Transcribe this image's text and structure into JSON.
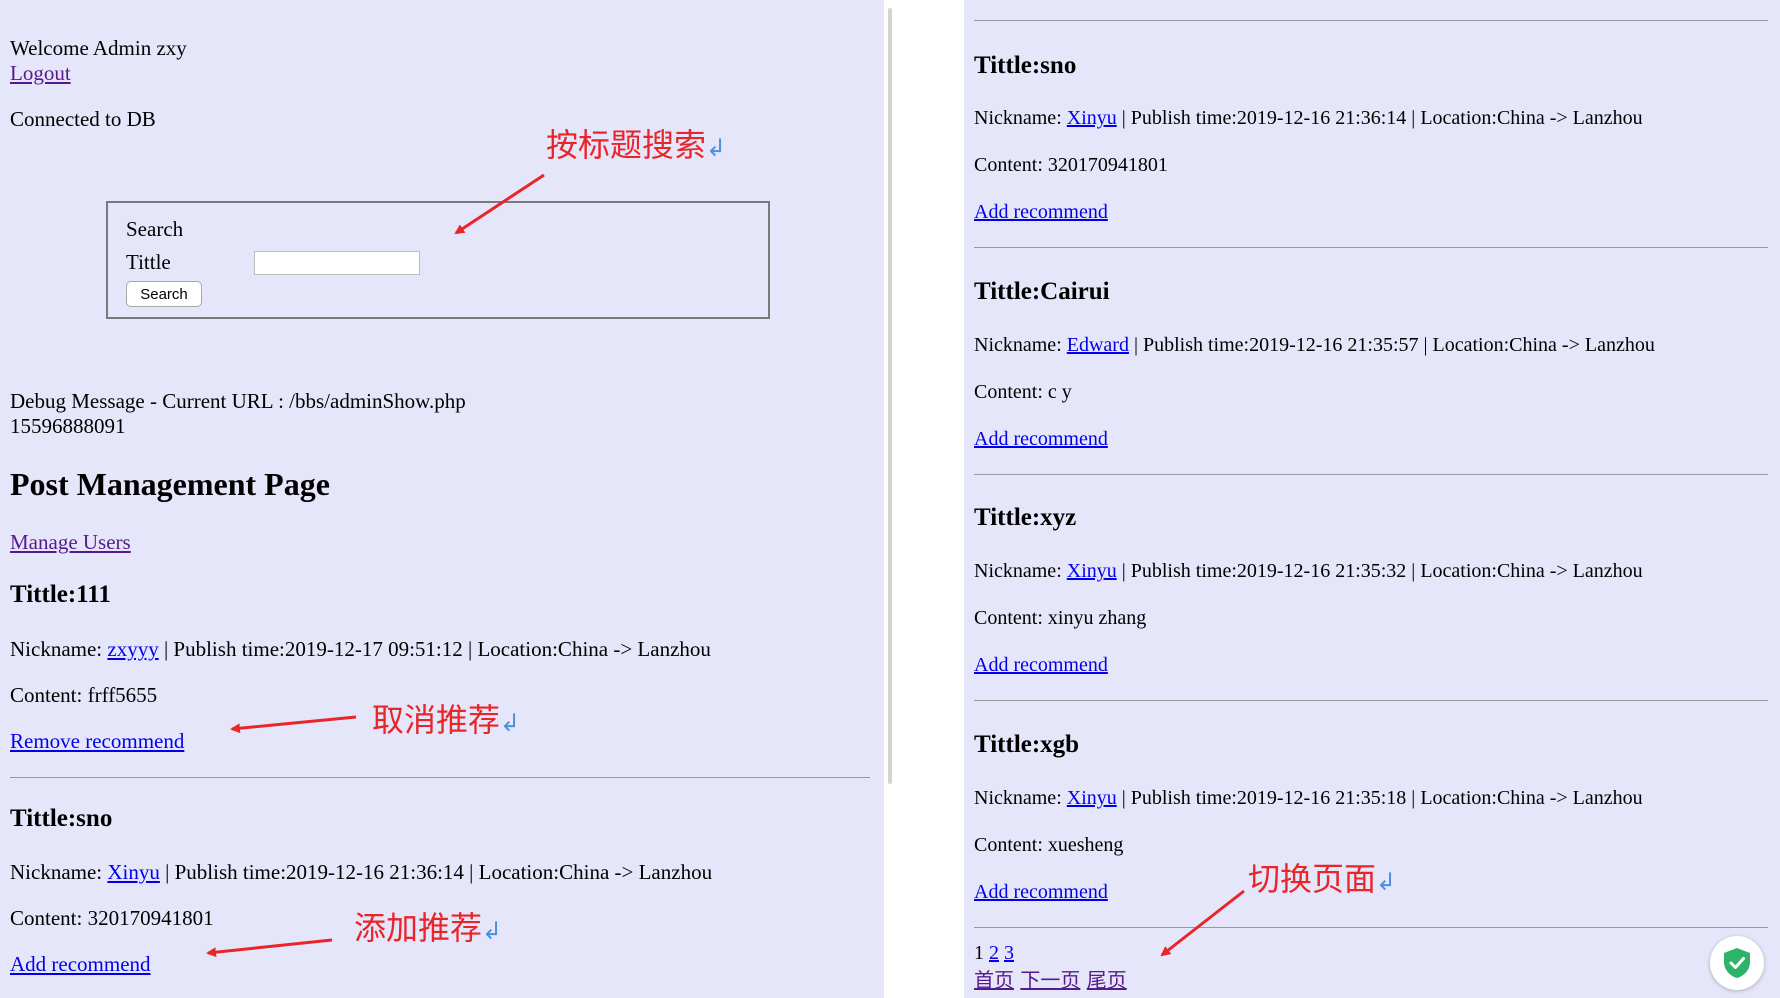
{
  "header": {
    "welcome": "Welcome Admin zxy",
    "logout": "Logout",
    "db_status": "Connected to DB"
  },
  "search": {
    "legend": "Search",
    "label": "Tittle",
    "value": "",
    "button": "Search"
  },
  "debug": {
    "message": "Debug Message - Current URL : /bbs/adminShow.php",
    "id": "15596888091"
  },
  "page_title": "Post Management Page",
  "manage_users": "Manage Users",
  "labels": {
    "nickname": "Nickname: ",
    "content": "Content: "
  },
  "posts_left": [
    {
      "title": "Tittle:111",
      "nickname": "zxyyy",
      "meta": " | Publish time:2019-12-17 09:51:12 | Location:China -> Lanzhou",
      "content": "frff5655",
      "action": "Remove recommend"
    },
    {
      "title": "Tittle:sno",
      "nickname": "Xinyu",
      "meta": " | Publish time:2019-12-16 21:36:14 | Location:China -> Lanzhou",
      "content": "320170941801",
      "action": "Add recommend"
    }
  ],
  "posts_right": [
    {
      "title": "Tittle:sno",
      "nickname": "Xinyu",
      "meta": " | Publish time:2019-12-16 21:36:14 | Location:China -> Lanzhou",
      "content": "320170941801",
      "action": "Add recommend"
    },
    {
      "title": "Tittle:Cairui",
      "nickname": "Edward",
      "meta": " | Publish time:2019-12-16 21:35:57 | Location:China -> Lanzhou",
      "content": "c y",
      "action": "Add recommend"
    },
    {
      "title": "Tittle:xyz",
      "nickname": "Xinyu",
      "meta": " | Publish time:2019-12-16 21:35:32 | Location:China -> Lanzhou",
      "content": "xinyu zhang",
      "action": "Add recommend"
    },
    {
      "title": "Tittle:xgb",
      "nickname": "Xinyu",
      "meta": " | Publish time:2019-12-16 21:35:18 | Location:China -> Lanzhou",
      "content": "xuesheng",
      "action": "Add recommend"
    }
  ],
  "pagination": {
    "current": "1",
    "pages": [
      "2",
      "3"
    ],
    "first": "首页",
    "next": "下一页",
    "last": "尾页"
  },
  "annotations": {
    "search_by_title": "按标题搜索",
    "cancel_recommend": "取消推荐",
    "add_recommend": "添加推荐",
    "switch_page": "切换页面",
    "return_mark": "↲"
  },
  "colors": {
    "background": "#e6e6fa",
    "link": "#0000ee",
    "visited_link": "#551a8b",
    "annotation": "#e8262a",
    "shield": "#2db36a"
  },
  "icons": {
    "security": "shield-check-icon"
  }
}
